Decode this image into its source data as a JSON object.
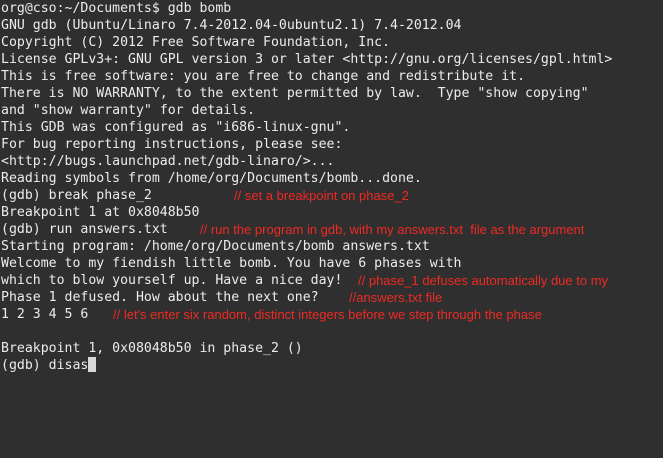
{
  "terminal": {
    "lines": [
      "org@cso:~/Documents$ gdb bomb",
      "GNU gdb (Ubuntu/Linaro 7.4-2012.04-0ubuntu2.1) 7.4-2012.04",
      "Copyright (C) 2012 Free Software Foundation, Inc.",
      "License GPLv3+: GNU GPL version 3 or later <http://gnu.org/licenses/gpl.html>",
      "This is free software: you are free to change and redistribute it.",
      "There is NO WARRANTY, to the extent permitted by law.  Type \"show copying\"",
      "and \"show warranty\" for details.",
      "This GDB was configured as \"i686-linux-gnu\".",
      "For bug reporting instructions, please see:",
      "<http://bugs.launchpad.net/gdb-linaro/>...",
      "Reading symbols from /home/org/Documents/bomb...done.",
      "(gdb) break phase_2",
      "Breakpoint 1 at 0x8048b50",
      "(gdb) run answers.txt",
      "Starting program: /home/org/Documents/bomb answers.txt",
      "Welcome to my fiendish little bomb. You have 6 phases with",
      "which to blow yourself up. Have a nice day!",
      "Phase 1 defused. How about the next one?",
      "1 2 3 4 5 6",
      "",
      "Breakpoint 1, 0x08048b50 in phase_2 ()",
      "(gdb) disas"
    ],
    "annotations": {
      "set_breakpoint": "// set a breakpoint on phase_2",
      "run_program": "// run the program in gdb, with my answers.txt  file as the argument",
      "phase1_defuses_a": "// phase_1 defuses automatically due to my",
      "phase1_defuses_b": "//answers.txt file",
      "six_integers": "// let's enter six random, distinct integers before we step through the phase"
    }
  },
  "colors": {
    "background": "#2f2f2f",
    "text": "#ececec",
    "annotation": "#ee2a24",
    "cursor": "#d8d8d8"
  }
}
